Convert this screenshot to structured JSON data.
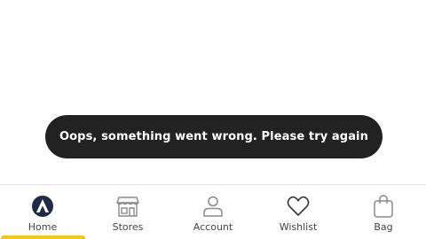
{
  "toast": {
    "message": "Oops, something went wrong. Please try again"
  },
  "nav": {
    "items": [
      {
        "label": "Home",
        "icon": "home-logo-icon",
        "active": true
      },
      {
        "label": "Stores",
        "icon": "store-icon",
        "active": false
      },
      {
        "label": "Account",
        "icon": "account-icon",
        "active": false
      },
      {
        "label": "Wishlist",
        "icon": "heart-icon",
        "active": false
      },
      {
        "label": "Bag",
        "icon": "bag-icon",
        "active": false
      }
    ]
  },
  "colors": {
    "toast_background": "#222222",
    "toast_text": "#ffffff",
    "active_indicator": "#f5c518",
    "icon_active": "#1f2a44",
    "icon_inactive": "#8a8a8a",
    "label": "#444444"
  }
}
